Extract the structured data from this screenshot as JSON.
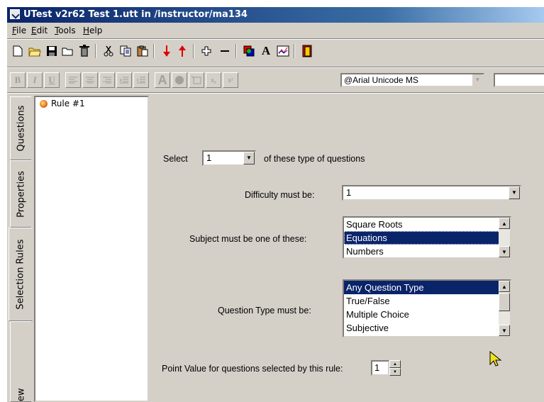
{
  "window": {
    "title": "UTest v2r62 Test 1.utt in /instructor/ma134"
  },
  "menu": {
    "items": [
      "File",
      "Edit",
      "Tools",
      "Help"
    ]
  },
  "toolbar": {
    "icons": [
      "new-icon",
      "open-icon",
      "save-icon",
      "folder-icon",
      "trash-icon",
      "cut-icon",
      "copy-icon",
      "paste-icon",
      "move-down-icon",
      "move-up-icon",
      "add-icon",
      "remove-icon",
      "palette-icon",
      "font-icon",
      "chart-icon",
      "exit-icon"
    ]
  },
  "format_toolbar": {
    "buttons": [
      "B",
      "I",
      "U"
    ],
    "font_name": "@Arial Unicode MS",
    "font_size": ""
  },
  "side_tabs": [
    "Questions",
    "Properties",
    "Selection Rules",
    "view"
  ],
  "tree": {
    "node_label": "Rule #1"
  },
  "form": {
    "select_label": "Select",
    "select_value": "1",
    "select_suffix": "of these type of questions",
    "difficulty_label": "Difficulty must be:",
    "difficulty_value": "1",
    "subject_label": "Subject must be one of these:",
    "subject_options": [
      "Square Roots",
      "Equations",
      "Numbers"
    ],
    "subject_selected": "Equations",
    "qtype_label": "Question Type must be:",
    "qtype_options": [
      "Any Question Type",
      "True/False",
      "Multiple Choice",
      "Subjective"
    ],
    "qtype_selected": "Any Question Type",
    "point_label": "Point Value for questions selected by this rule:",
    "point_value": "1"
  }
}
